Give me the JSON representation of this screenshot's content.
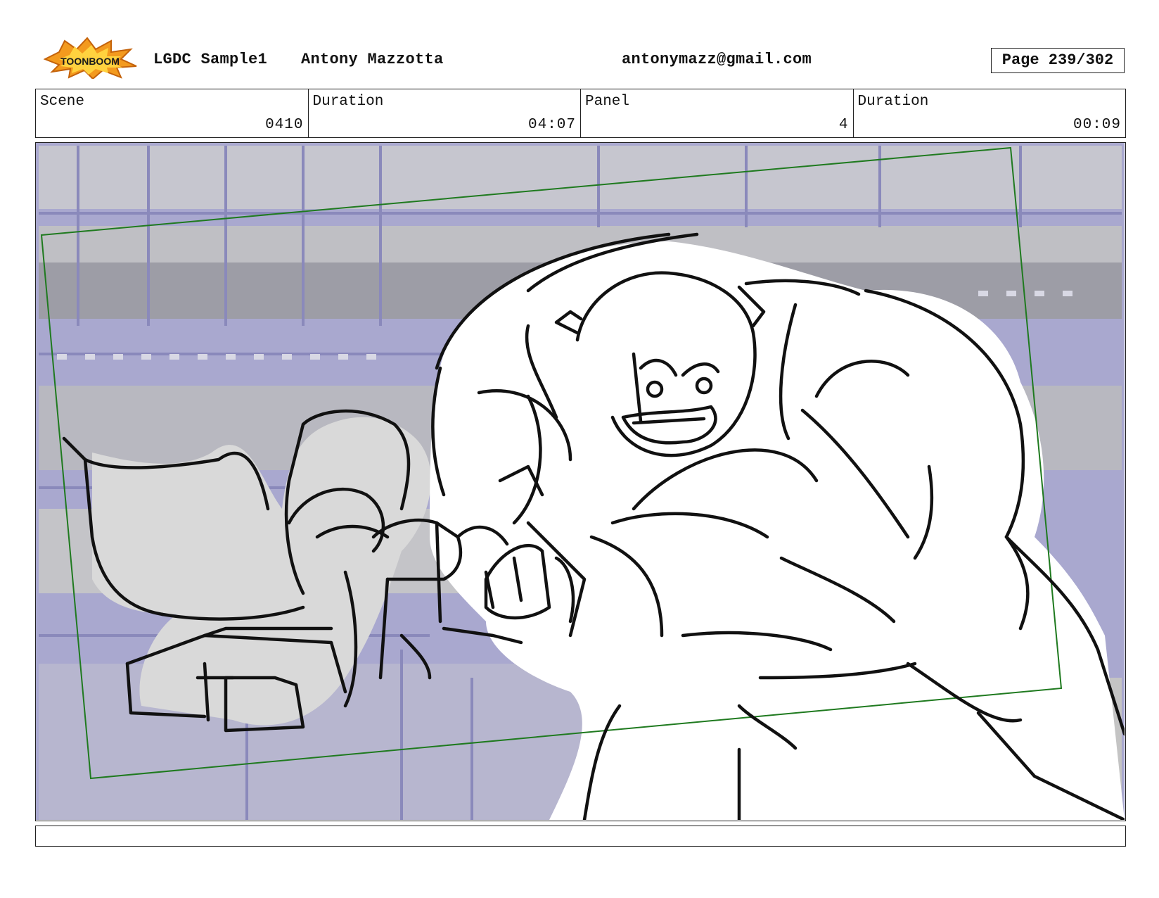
{
  "header": {
    "logo_text": "TOONBOOM",
    "project": "LGDC Sample1",
    "author": "Antony Mazzotta",
    "email": "antonymazz@gmail.com",
    "page": "Page 239/302"
  },
  "fields": {
    "scene_label": "Scene",
    "scene_value": "0410",
    "scene_duration_label": "Duration",
    "scene_duration_value": "04:07",
    "panel_label": "Panel",
    "panel_value": "4",
    "panel_duration_label": "Duration",
    "panel_duration_value": "00:09"
  },
  "notes": "",
  "colors": {
    "background_lavender": "#a9a8cf",
    "background_gray": "#c4c4c4",
    "shadow_gray": "#d6d6d6",
    "camera_frame": "#1f7a1f",
    "ink": "#111111",
    "logo_orange": "#f39a1e"
  }
}
